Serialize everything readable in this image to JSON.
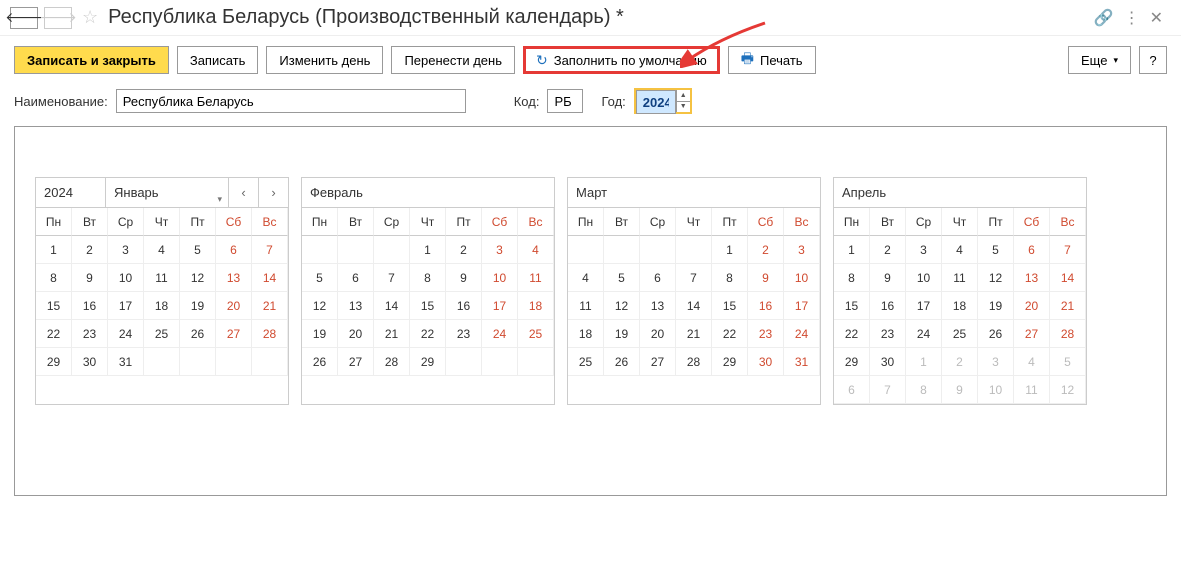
{
  "header": {
    "title": "Республика Беларусь (Производственный календарь) *"
  },
  "toolbar": {
    "save_close": "Записать и закрыть",
    "save": "Записать",
    "change_day": "Изменить день",
    "move_day": "Перенести день",
    "fill_default": "Заполнить по умолчанию",
    "print": "Печать",
    "more": "Еще"
  },
  "form": {
    "name_label": "Наименование:",
    "name_value": "Республика Беларусь",
    "code_label": "Код:",
    "code_value": "РБ",
    "year_label": "Год:",
    "year_value": "2024"
  },
  "dow": [
    "Пн",
    "Вт",
    "Ср",
    "Чт",
    "Пт",
    "Сб",
    "Вс"
  ],
  "months": [
    {
      "year": "2024",
      "name": "Январь",
      "first_with_nav": true,
      "weeks": [
        [
          {
            "d": 1
          },
          {
            "d": 2
          },
          {
            "d": 3
          },
          {
            "d": 4
          },
          {
            "d": 5
          },
          {
            "d": 6,
            "we": true
          },
          {
            "d": 7,
            "we": true
          }
        ],
        [
          {
            "d": 8
          },
          {
            "d": 9
          },
          {
            "d": 10
          },
          {
            "d": 11
          },
          {
            "d": 12
          },
          {
            "d": 13,
            "we": true
          },
          {
            "d": 14,
            "we": true
          }
        ],
        [
          {
            "d": 15
          },
          {
            "d": 16
          },
          {
            "d": 17
          },
          {
            "d": 18
          },
          {
            "d": 19
          },
          {
            "d": 20,
            "we": true
          },
          {
            "d": 21,
            "we": true
          }
        ],
        [
          {
            "d": 22
          },
          {
            "d": 23
          },
          {
            "d": 24
          },
          {
            "d": 25
          },
          {
            "d": 26
          },
          {
            "d": 27,
            "we": true
          },
          {
            "d": 28,
            "we": true
          }
        ],
        [
          {
            "d": 29
          },
          {
            "d": 30
          },
          {
            "d": 31
          },
          {
            "d": ""
          },
          {
            "d": ""
          },
          {
            "d": ""
          },
          {
            "d": ""
          }
        ]
      ]
    },
    {
      "name": "Февраль",
      "weeks": [
        [
          {
            "d": ""
          },
          {
            "d": ""
          },
          {
            "d": ""
          },
          {
            "d": 1
          },
          {
            "d": 2
          },
          {
            "d": 3,
            "we": true
          },
          {
            "d": 4,
            "we": true
          }
        ],
        [
          {
            "d": 5
          },
          {
            "d": 6
          },
          {
            "d": 7
          },
          {
            "d": 8
          },
          {
            "d": 9
          },
          {
            "d": 10,
            "we": true
          },
          {
            "d": 11,
            "we": true
          }
        ],
        [
          {
            "d": 12
          },
          {
            "d": 13
          },
          {
            "d": 14
          },
          {
            "d": 15
          },
          {
            "d": 16
          },
          {
            "d": 17,
            "we": true
          },
          {
            "d": 18,
            "we": true
          }
        ],
        [
          {
            "d": 19
          },
          {
            "d": 20
          },
          {
            "d": 21
          },
          {
            "d": 22
          },
          {
            "d": 23
          },
          {
            "d": 24,
            "we": true
          },
          {
            "d": 25,
            "we": true
          }
        ],
        [
          {
            "d": 26
          },
          {
            "d": 27
          },
          {
            "d": 28
          },
          {
            "d": 29
          },
          {
            "d": ""
          },
          {
            "d": ""
          },
          {
            "d": ""
          }
        ]
      ]
    },
    {
      "name": "Март",
      "weeks": [
        [
          {
            "d": ""
          },
          {
            "d": ""
          },
          {
            "d": ""
          },
          {
            "d": ""
          },
          {
            "d": 1
          },
          {
            "d": 2,
            "we": true
          },
          {
            "d": 3,
            "we": true
          }
        ],
        [
          {
            "d": 4
          },
          {
            "d": 5
          },
          {
            "d": 6
          },
          {
            "d": 7
          },
          {
            "d": 8
          },
          {
            "d": 9,
            "we": true
          },
          {
            "d": 10,
            "we": true
          }
        ],
        [
          {
            "d": 11
          },
          {
            "d": 12
          },
          {
            "d": 13
          },
          {
            "d": 14
          },
          {
            "d": 15
          },
          {
            "d": 16,
            "we": true
          },
          {
            "d": 17,
            "we": true
          }
        ],
        [
          {
            "d": 18
          },
          {
            "d": 19
          },
          {
            "d": 20
          },
          {
            "d": 21
          },
          {
            "d": 22
          },
          {
            "d": 23,
            "we": true
          },
          {
            "d": 24,
            "we": true
          }
        ],
        [
          {
            "d": 25
          },
          {
            "d": 26
          },
          {
            "d": 27
          },
          {
            "d": 28
          },
          {
            "d": 29
          },
          {
            "d": 30,
            "we": true
          },
          {
            "d": 31,
            "we": true
          }
        ]
      ]
    },
    {
      "name": "Апрель",
      "weeks": [
        [
          {
            "d": 1
          },
          {
            "d": 2
          },
          {
            "d": 3
          },
          {
            "d": 4
          },
          {
            "d": 5
          },
          {
            "d": 6,
            "we": true
          },
          {
            "d": 7,
            "we": true
          }
        ],
        [
          {
            "d": 8
          },
          {
            "d": 9
          },
          {
            "d": 10
          },
          {
            "d": 11
          },
          {
            "d": 12
          },
          {
            "d": 13,
            "we": true
          },
          {
            "d": 14,
            "we": true
          }
        ],
        [
          {
            "d": 15
          },
          {
            "d": 16
          },
          {
            "d": 17
          },
          {
            "d": 18
          },
          {
            "d": 19
          },
          {
            "d": 20,
            "we": true
          },
          {
            "d": 21,
            "we": true
          }
        ],
        [
          {
            "d": 22
          },
          {
            "d": 23
          },
          {
            "d": 24
          },
          {
            "d": 25
          },
          {
            "d": 26
          },
          {
            "d": 27,
            "we": true
          },
          {
            "d": 28,
            "we": true
          }
        ],
        [
          {
            "d": 29
          },
          {
            "d": 30
          },
          {
            "d": 1,
            "other": true
          },
          {
            "d": 2,
            "other": true
          },
          {
            "d": 3,
            "other": true
          },
          {
            "d": 4,
            "other": true
          },
          {
            "d": 5,
            "other": true
          }
        ],
        [
          {
            "d": 6,
            "other": true
          },
          {
            "d": 7,
            "other": true
          },
          {
            "d": 8,
            "other": true
          },
          {
            "d": 9,
            "other": true
          },
          {
            "d": 10,
            "other": true
          },
          {
            "d": 11,
            "other": true
          },
          {
            "d": 12,
            "other": true
          }
        ]
      ]
    }
  ]
}
